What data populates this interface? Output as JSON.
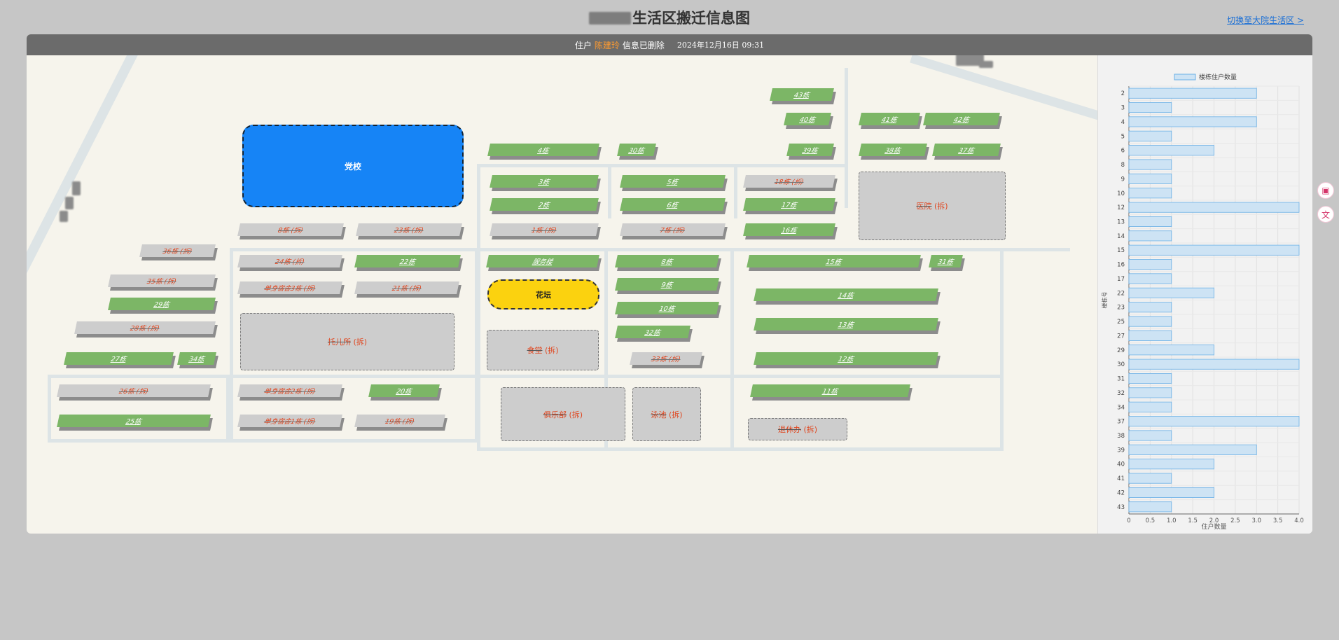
{
  "header": {
    "title_suffix": "生活区搬迁信息图",
    "switch_link": "切换至大院生活区 >"
  },
  "notice": {
    "prefix": "住户",
    "name": "陈建玲",
    "suffix": "信息已删除",
    "timestamp": "2024年12月16日 09:31"
  },
  "map": {
    "party_school": "党校",
    "flowerbed": "花坛",
    "buildings": [
      {
        "id": "b43",
        "label": "43栋",
        "status": "active"
      },
      {
        "id": "b40",
        "label": "40栋",
        "status": "active"
      },
      {
        "id": "b41",
        "label": "41栋",
        "status": "active"
      },
      {
        "id": "b42",
        "label": "42栋",
        "status": "active"
      },
      {
        "id": "b4",
        "label": "4栋",
        "status": "active"
      },
      {
        "id": "b30",
        "label": "30栋",
        "status": "active"
      },
      {
        "id": "b39",
        "label": "39栋",
        "status": "active"
      },
      {
        "id": "b38",
        "label": "38栋",
        "status": "active"
      },
      {
        "id": "b37",
        "label": "37栋",
        "status": "active"
      },
      {
        "id": "b3",
        "label": "3栋",
        "status": "active"
      },
      {
        "id": "b5",
        "label": "5栋",
        "status": "active"
      },
      {
        "id": "b18",
        "label": "18栋 (拆)",
        "status": "demolished"
      },
      {
        "id": "b2",
        "label": "2栋",
        "status": "active"
      },
      {
        "id": "b6",
        "label": "6栋",
        "status": "active"
      },
      {
        "id": "b17",
        "label": "17栋",
        "status": "active"
      },
      {
        "id": "b8d",
        "label": "8栋 (拆)",
        "status": "demolished"
      },
      {
        "id": "b23",
        "label": "23栋 (拆)",
        "status": "demolished"
      },
      {
        "id": "b1",
        "label": "1栋 (拆)",
        "status": "demolished"
      },
      {
        "id": "b7",
        "label": "7栋 (拆)",
        "status": "demolished"
      },
      {
        "id": "b16",
        "label": "16栋",
        "status": "active"
      },
      {
        "id": "b36",
        "label": "36栋 (拆)",
        "status": "demolished"
      },
      {
        "id": "b24",
        "label": "24栋 (拆)",
        "status": "demolished"
      },
      {
        "id": "b22",
        "label": "22栋",
        "status": "active"
      },
      {
        "id": "bsvc",
        "label": "服务楼",
        "status": "active"
      },
      {
        "id": "b8",
        "label": "8栋",
        "status": "active"
      },
      {
        "id": "b15",
        "label": "15栋",
        "status": "active"
      },
      {
        "id": "b31",
        "label": "31栋",
        "status": "active"
      },
      {
        "id": "b35",
        "label": "35栋 (拆)",
        "status": "demolished"
      },
      {
        "id": "bdorm3",
        "label": "单身宿舍3栋 (拆)",
        "status": "demolished"
      },
      {
        "id": "b21",
        "label": "21栋 (拆)",
        "status": "demolished"
      },
      {
        "id": "b9",
        "label": "9栋",
        "status": "active"
      },
      {
        "id": "b14",
        "label": "14栋",
        "status": "active"
      },
      {
        "id": "b29",
        "label": "29栋",
        "status": "active"
      },
      {
        "id": "b10",
        "label": "10栋",
        "status": "active"
      },
      {
        "id": "b28",
        "label": "28栋 (拆)",
        "status": "demolished"
      },
      {
        "id": "b13",
        "label": "13栋",
        "status": "active"
      },
      {
        "id": "b32",
        "label": "32栋",
        "status": "active"
      },
      {
        "id": "b27",
        "label": "27栋",
        "status": "active"
      },
      {
        "id": "b34",
        "label": "34栋",
        "status": "active"
      },
      {
        "id": "b33",
        "label": "33栋 (拆)",
        "status": "demolished"
      },
      {
        "id": "b12",
        "label": "12栋",
        "status": "active"
      },
      {
        "id": "b26",
        "label": "26栋 (拆)",
        "status": "demolished"
      },
      {
        "id": "bdorm2",
        "label": "单身宿舍2栋 (拆)",
        "status": "demolished"
      },
      {
        "id": "b20",
        "label": "20栋",
        "status": "active"
      },
      {
        "id": "b11",
        "label": "11栋",
        "status": "active"
      },
      {
        "id": "b25",
        "label": "25栋",
        "status": "active"
      },
      {
        "id": "bdorm1",
        "label": "单身宿舍1栋 (拆)",
        "status": "demolished"
      },
      {
        "id": "b19",
        "label": "19栋 (拆)",
        "status": "demolished"
      }
    ],
    "zones": {
      "hospital_name": "医院",
      "nursery_name": "托儿所",
      "canteen_name": "食堂",
      "club_name": "俱乐部",
      "pool_name": "泳池",
      "retire_name": "退休办",
      "demolished_tag": "(拆)"
    }
  },
  "chart_data": {
    "type": "bar",
    "orientation": "horizontal",
    "legend": "楼栋住户数量",
    "legend_position": "top",
    "ylabel": "楼栋号",
    "xlabel": "住户数量",
    "xlim": [
      0,
      4.0
    ],
    "xticks": [
      "0",
      "0.5",
      "1.0",
      "1.5",
      "2.0",
      "2.5",
      "3.0",
      "3.5",
      "4.0"
    ],
    "grid": true,
    "categories": [
      "2",
      "3",
      "4",
      "5",
      "6",
      "8",
      "9",
      "10",
      "12",
      "13",
      "14",
      "15",
      "16",
      "17",
      "22",
      "23",
      "25",
      "27",
      "29",
      "30",
      "31",
      "32",
      "34",
      "37",
      "38",
      "39",
      "40",
      "41",
      "42",
      "43"
    ],
    "series": [
      {
        "name": "楼栋住户数量",
        "values": [
          3,
          1,
          3,
          1,
          2,
          1,
          1,
          1,
          4,
          1,
          1,
          4,
          1,
          1,
          2,
          1,
          1,
          1,
          2,
          4,
          1,
          1,
          1,
          4,
          1,
          3,
          2,
          1,
          2,
          1
        ]
      }
    ],
    "colors": {
      "bar_fill": "#cde3f4",
      "bar_stroke": "#6ab0e6"
    }
  }
}
